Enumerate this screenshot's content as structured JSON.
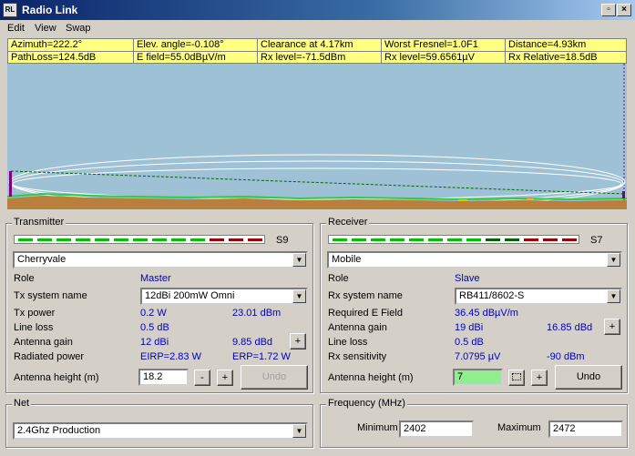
{
  "window": {
    "title": "Radio Link",
    "icon_text": "RL"
  },
  "menu": [
    {
      "label": "Edit"
    },
    {
      "label": "View"
    },
    {
      "label": "Swap"
    }
  ],
  "info": {
    "row1": [
      "Azimuth=222.2°",
      "Elev. angle=-0.108°",
      "Clearance at 4.17km",
      "Worst Fresnel=1.0F1",
      "Distance=4.93km"
    ],
    "row2": [
      "PathLoss=124.5dB",
      "E field=55.0dBµV/m",
      "Rx level=-71.5dBm",
      "Rx level=59.6561µV",
      "Rx Relative=18.5dB"
    ]
  },
  "colors": {
    "info_bg": "#ffff80",
    "sky": "#9ec1d6",
    "terrain": "#b8803c",
    "vegetation": "#2ecc40",
    "link_line": "#006400",
    "meter_green": "#00c000",
    "meter_dark_green": "#006400",
    "meter_red": "#a00000",
    "value_blue": "#0000c0"
  },
  "transmitter": {
    "group_title": "Transmitter",
    "signal_label": "S9",
    "meter": [
      "green",
      "green",
      "green",
      "green",
      "green",
      "green",
      "green",
      "green",
      "green",
      "green",
      "red",
      "red",
      "red"
    ],
    "site": "Cherryvale",
    "role_label": "Role",
    "role_value": "Master",
    "system_label": "Tx system name",
    "system_value": "12dBi 200mW Omni",
    "power_label": "Tx power",
    "power_w": "0.2 W",
    "power_dbm": "23.01 dBm",
    "loss_label": "Line loss",
    "loss_value": "0.5 dB",
    "gain_label": "Antenna gain",
    "gain_dbi": "12 dBi",
    "gain_dbd": "9.85 dBd",
    "radiated_label": "Radiated power",
    "eirp": "EIRP=2.83 W",
    "erp": "ERP=1.72 W",
    "height_label": "Antenna height (m)",
    "height_value": "18.2",
    "minus": "-",
    "plus": "+",
    "undo": "Undo"
  },
  "receiver": {
    "group_title": "Receiver",
    "signal_label": "S7",
    "meter": [
      "green",
      "green",
      "green",
      "green",
      "green",
      "green",
      "green",
      "green",
      "darkgreen",
      "darkgreen",
      "red",
      "red",
      "red",
      "red",
      "red"
    ],
    "site": "Mobile",
    "role_label": "Role",
    "role_value": "Slave",
    "system_label": "Rx system name",
    "system_value": "RB411/8602-S",
    "efield_label": "Required E Field",
    "efield_value": "36.45 dBµV/m",
    "gain_label": "Antenna gain",
    "gain_dbi": "19 dBi",
    "gain_dbd": "16.85 dBd",
    "loss_label": "Line loss",
    "loss_value": "0.5 dB",
    "sens_label": "Rx sensitivity",
    "sens_uv": "7.0795 µV",
    "sens_dbm": "-90 dBm",
    "height_label": "Antenna height (m)",
    "height_value": "7",
    "plus": "+",
    "undo": "Undo"
  },
  "net": {
    "group_title": "Net",
    "value": "2.4Ghz Production"
  },
  "frequency": {
    "group_title": "Frequency (MHz)",
    "min_label": "Minimum",
    "min_value": "2402",
    "max_label": "Maximum",
    "max_value": "2472"
  }
}
